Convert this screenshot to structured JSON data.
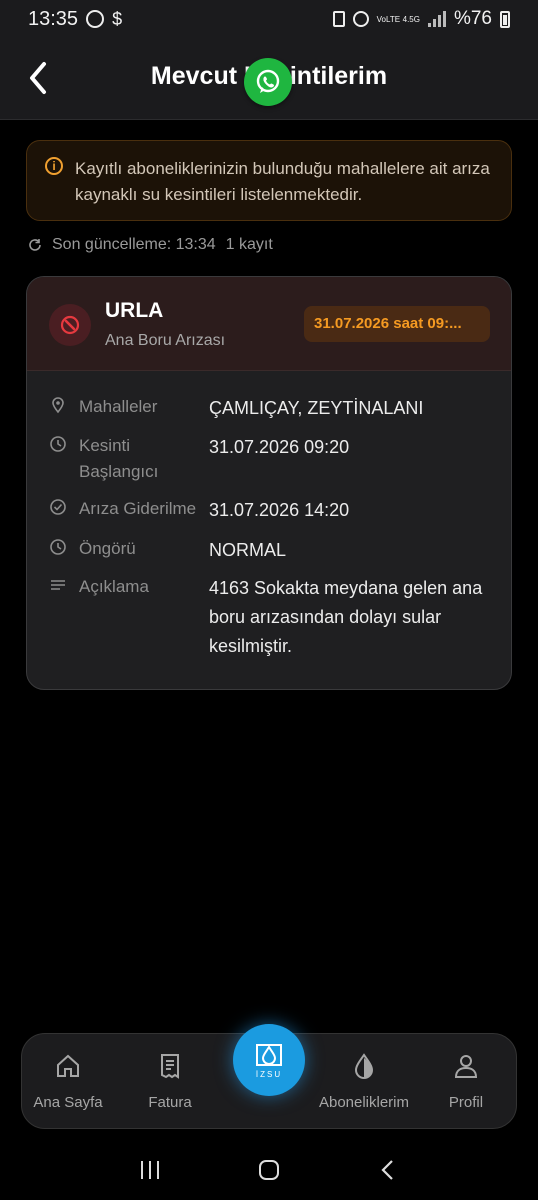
{
  "status_bar": {
    "time": "13:35",
    "battery": "%76",
    "network_label": "4.5G",
    "volte_label": "VoLTE"
  },
  "header": {
    "title": "Mevcut Kesintilerim"
  },
  "info_banner": {
    "text": "Kayıtlı aboneliklerinizin bulunduğu mahallelere ait arıza kaynaklı su kesintileri listelenmektedir."
  },
  "update_info": {
    "last_update": "Son güncelleme: 13:34",
    "count": "1 kayıt"
  },
  "outage": {
    "district": "URLA",
    "type": "Ana Boru Arızası",
    "date_badge": "31.07.2026 saat 09:...",
    "fields": [
      {
        "label": "Mahalleler",
        "value": "ÇAMLIÇAY, ZEYTİNALANI",
        "icon": "location-pin-icon"
      },
      {
        "label": "Kesinti Başlangıcı",
        "value": "31.07.2026 09:20",
        "icon": "clock-icon"
      },
      {
        "label": "Arıza Giderilme",
        "value": "31.07.2026 14:20",
        "icon": "check-circle-icon"
      },
      {
        "label": "Öngörü",
        "value": "NORMAL",
        "icon": "clock-icon"
      },
      {
        "label": "Açıklama",
        "value": "4163 Sokakta meydana gelen ana boru arızasından dolayı sular kesilmiştir.",
        "icon": "description-lines-icon"
      }
    ]
  },
  "bottom_nav": {
    "items": [
      {
        "label": "Ana Sayfa",
        "icon": "home-icon"
      },
      {
        "label": "Fatura",
        "icon": "invoice-icon"
      },
      {
        "label": "Aboneliklerim",
        "icon": "water-drop-icon"
      },
      {
        "label": "Profil",
        "icon": "person-icon"
      }
    ],
    "center_logo_text": "İZSU"
  },
  "colors": {
    "background": "#000000",
    "accent_orange": "#f59a22",
    "accent_blue": "#1b9be0",
    "danger_red": "#e5393f",
    "whatsapp_green": "#1fb640"
  }
}
